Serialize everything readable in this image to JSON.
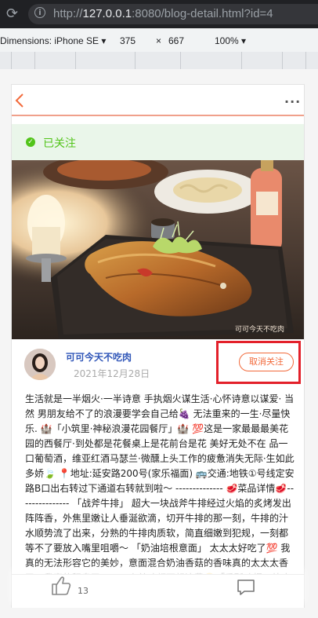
{
  "browser": {
    "url_prefix": "http://",
    "url_host": "127.0.0.1",
    "url_rest": ":8080/blog-detail.html?id=4"
  },
  "devtools": {
    "dimensions_label": "Dimensions: iPhone SE",
    "width": "375",
    "times": "×",
    "height": "667",
    "zoom": "100%"
  },
  "post": {
    "follow_status": "已关注",
    "photo_watermark": "可可今天不吃肉",
    "author_name": "可可今天不吃肉",
    "date": "2021年12月28日",
    "unfollow_label": "取消关注",
    "content": "生活就是一半烟火·一半诗意 手执烟火谋生活·心怀诗意以谋爱· 当然 男朋友给不了的浪漫要学会自己给🍇 无法重来的一生·尽量快乐. 🏰「小筑里·神秘浪漫花园餐厅」🏰 💯这是一家最最最美花园的西餐厅·到处都是花餐桌上是花前台是花 美好无处不在 品一口葡萄酒，维亚红酒马瑟兰·微醺上头工作的疲惫消失无际·生如此多娇🍃 📍地址:延安路200号(家乐福面) 🚌交通:地铁①号线定安路B口出右转过下通道右转就到啦～ -------------- 🥩菜品详情🥩--------------- 「战斧牛排」 超大一块战斧牛排经过火焰的炙烤发出阵阵香，外焦里嫩让人垂涎欲滴，切开牛排的那一刻，牛排的汁水顺势流了出来，分熟的牛排肉质软，简直细嫩到犯规，一刻都等不了要放入嘴里咀嚼～ 「奶油培根意面」 太太太好吃了💯 我真的无法形容它的美妙，意面混合奶油香菇的香味真的太太太香了，我真的舔盘了，一丁点美味都不想浪费🤭「香酥鸡翅」外皮金黄酥脆咬一口汁水四溢"
  },
  "actions": {
    "like_count": "13"
  }
}
